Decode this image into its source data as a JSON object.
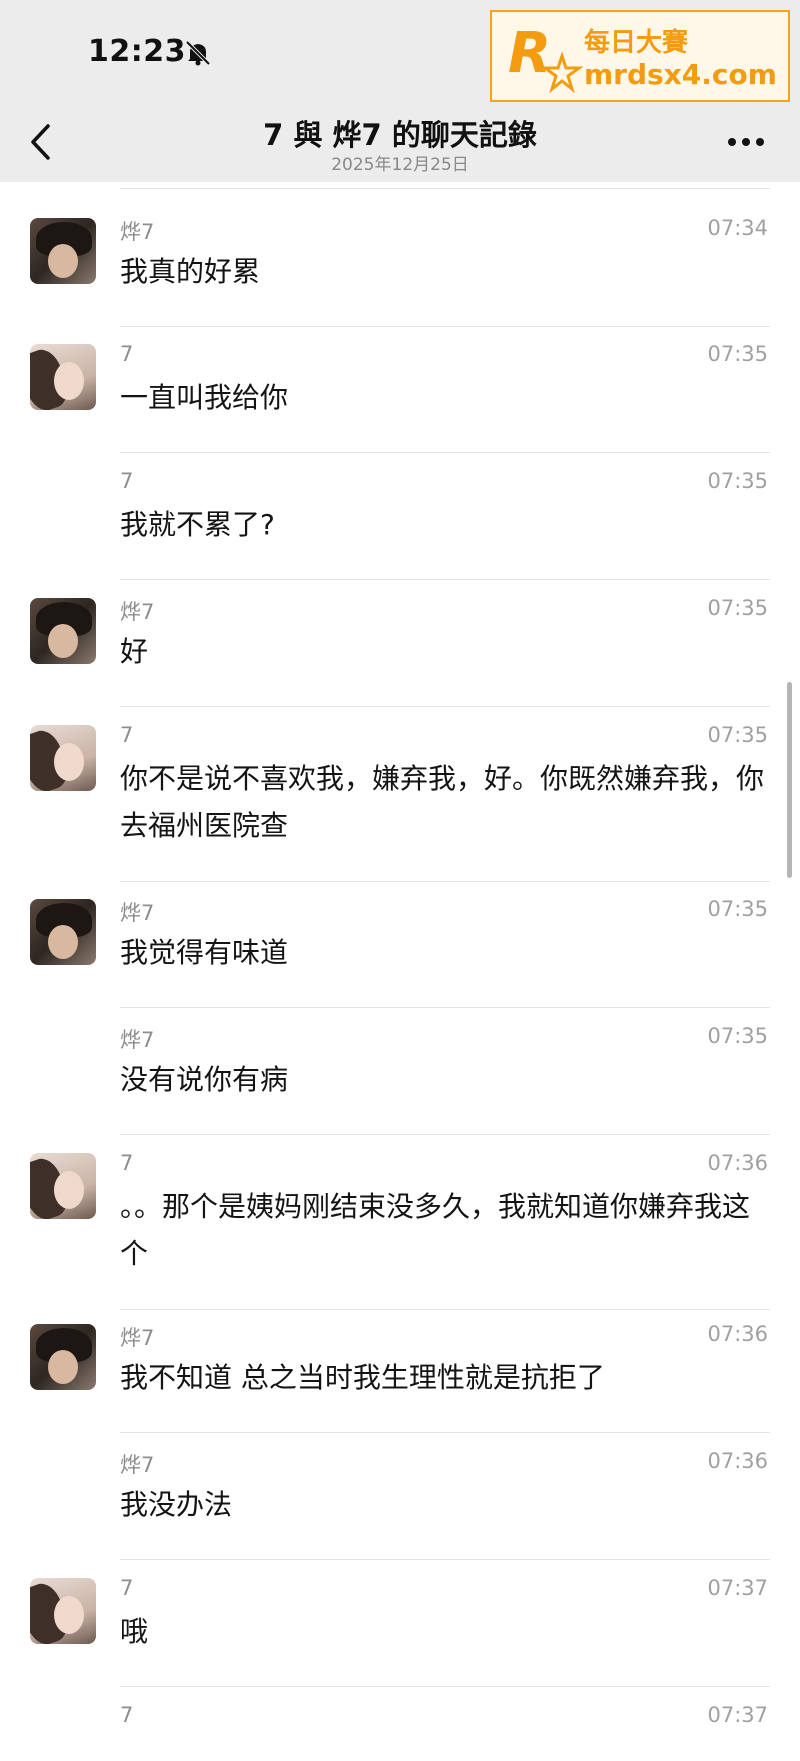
{
  "status_bar": {
    "time": "12:23"
  },
  "watermark": {
    "line1": "每日大賽",
    "line2": "mrdsx4.com"
  },
  "header": {
    "title": "7 與 烨7 的聊天記錄",
    "date": "2025年12月25日"
  },
  "icons": {
    "back": "chevron-left-icon",
    "more": "more-horizontal-icon",
    "silent": "bell-slash-icon"
  },
  "messages": [
    {
      "sender": "烨7",
      "time": "07:34",
      "text": "我真的好累",
      "avatar": "avatar-a"
    },
    {
      "sender": "7",
      "time": "07:35",
      "text": "一直叫我给你",
      "avatar": "avatar-b"
    },
    {
      "sender": "7",
      "time": "07:35",
      "text": "我就不累了?",
      "avatar": ""
    },
    {
      "sender": "烨7",
      "time": "07:35",
      "text": "好",
      "avatar": "avatar-a"
    },
    {
      "sender": "7",
      "time": "07:35",
      "text": "你不是说不喜欢我，嫌弃我，好。你既然嫌弃我，你去福州医院查",
      "avatar": "avatar-b"
    },
    {
      "sender": "烨7",
      "time": "07:35",
      "text": "我觉得有味道",
      "avatar": "avatar-a"
    },
    {
      "sender": "烨7",
      "time": "07:35",
      "text": "没有说你有病",
      "avatar": ""
    },
    {
      "sender": "7",
      "time": "07:36",
      "text": "。。那个是姨妈刚结束没多久，我就知道你嫌弃我这个",
      "avatar": "avatar-b"
    },
    {
      "sender": "烨7",
      "time": "07:36",
      "text": "我不知道 总之当时我生理性就是抗拒了",
      "avatar": "avatar-a"
    },
    {
      "sender": "烨7",
      "time": "07:36",
      "text": "我没办法",
      "avatar": ""
    },
    {
      "sender": "7",
      "time": "07:37",
      "text": "哦",
      "avatar": "avatar-b"
    },
    {
      "sender": "7",
      "time": "07:37",
      "text": "",
      "avatar": ""
    }
  ]
}
